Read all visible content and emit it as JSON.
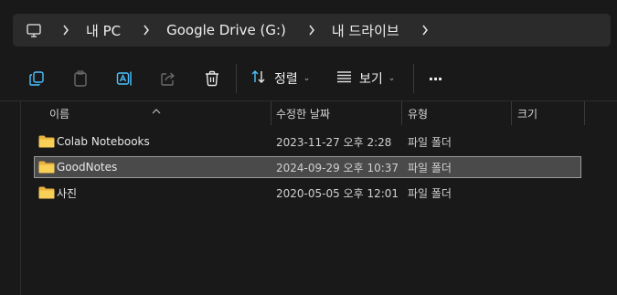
{
  "address_bar": {
    "crumbs": [
      "내 PC",
      "Google Drive (G:)",
      "내 드라이브"
    ]
  },
  "toolbar": {
    "icons": [
      "copy-icon",
      "paste-icon",
      "rename-icon",
      "share-icon",
      "delete-icon"
    ],
    "sort_label": "정렬",
    "view_label": "보기",
    "more_label": "···"
  },
  "columns": {
    "name": "이름",
    "modified": "수정한 날짜",
    "type": "유형",
    "size": "크기"
  },
  "files": [
    {
      "name": "Colab Notebooks",
      "modified": "2023-11-27 오후 2:28",
      "type": "파일 폴더",
      "selected": false
    },
    {
      "name": "GoodNotes",
      "modified": "2024-09-29 오후 10:37",
      "type": "파일 폴더",
      "selected": true
    },
    {
      "name": "사진",
      "modified": "2020-05-05 오후 12:01",
      "type": "파일 폴더",
      "selected": false
    }
  ],
  "colors": {
    "background": "#191919",
    "address_bg": "#2b2b2b",
    "folder": "#f4c246",
    "accent": "#4cc2ff",
    "selection": "#4a4a4a"
  }
}
